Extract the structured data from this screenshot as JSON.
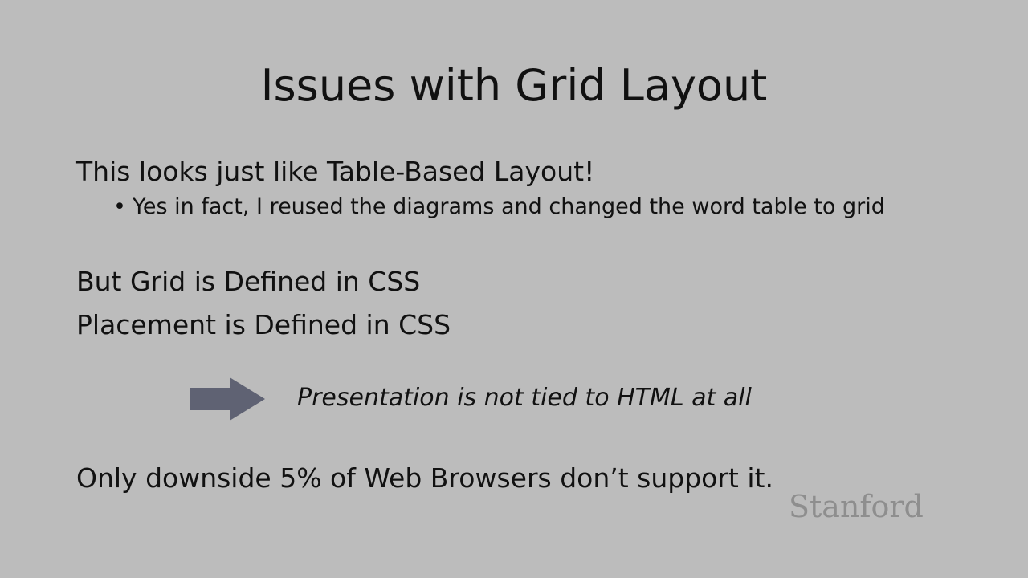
{
  "slide": {
    "title": "Issues with Grid Layout",
    "line1": "This looks just like Table-Based Layout!",
    "bullet": {
      "glyph": "•",
      "text": "Yes in fact, I reused the diagrams and changed the word table to grid"
    },
    "line2": "But Grid is Defined in CSS",
    "line3": "Placement is Defined in CSS",
    "arrow_icon": "right-arrow-icon",
    "arrow_color": "#5f6273",
    "conclusion": "Presentation is not tied to HTML at all",
    "line4": "Only downside 5% of Web Browsers don’t support it.",
    "logo_text": "Stanford"
  }
}
